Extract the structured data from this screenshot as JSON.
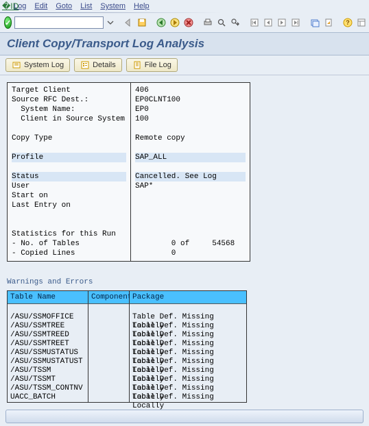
{
  "menu": {
    "items": [
      "Log",
      "Edit",
      "Goto",
      "List",
      "System",
      "Help"
    ]
  },
  "title": "Client Copy/Transport Log Analysis",
  "appButtons": {
    "systemLog": "System Log",
    "details": "Details",
    "fileLog": "File Log"
  },
  "info": {
    "labels": {
      "targetClient": "Target Client",
      "sourceRfc": "Source RFC Dest.:",
      "systemName": "  System Name:",
      "clientInSrc": "  Client in Source System",
      "copyType": "Copy Type",
      "profile": "Profile",
      "status": "Status",
      "user": "User",
      "startOn": "Start on",
      "lastEntry": "Last Entry on",
      "statsHdr": "Statistics for this Run",
      "noTables": "- No. of Tables",
      "copiedLines": "- Copied Lines"
    },
    "values": {
      "targetClient": "406",
      "sourceRfc": "EP0CLNT100",
      "systemName": "EP0",
      "clientInSrc": "100",
      "copyType": "Remote copy",
      "profile": "SAP_ALL",
      "status": "Cancelled. See Log",
      "user": "SAP*",
      "startOn": "",
      "lastEntry": "",
      "noTables": "        0 of     54568",
      "copiedLines": "        0"
    }
  },
  "warnings": {
    "title": "Warnings and Errors",
    "headers": {
      "table": "Table Name",
      "component": "Component",
      "package": "Package"
    },
    "rows": [
      {
        "table": "/ASU/SSMOFFICE",
        "component": "",
        "package": "Table Def. Missing Locally"
      },
      {
        "table": "/ASU/SSMTREE",
        "component": "",
        "package": "Table Def. Missing Locally"
      },
      {
        "table": "/ASU/SSMTREED",
        "component": "",
        "package": "Table Def. Missing Locally"
      },
      {
        "table": "/ASU/SSMTREET",
        "component": "",
        "package": "Table Def. Missing Locally"
      },
      {
        "table": "/ASU/SSMUSTATUS",
        "component": "",
        "package": "Table Def. Missing Locally"
      },
      {
        "table": "/ASU/SSMUSTATUST",
        "component": "",
        "package": "Table Def. Missing Locally"
      },
      {
        "table": "/ASU/TSSM",
        "component": "",
        "package": "Table Def. Missing Locally"
      },
      {
        "table": "/ASU/TSSMT",
        "component": "",
        "package": "Table Def. Missing Locally"
      },
      {
        "table": "/ASU/TSSM_CONTNV",
        "component": "",
        "package": "Table Def. Missing Locally"
      },
      {
        "table": "UACC_BATCH",
        "component": "",
        "package": "Table Def. Missing Locally"
      }
    ]
  }
}
